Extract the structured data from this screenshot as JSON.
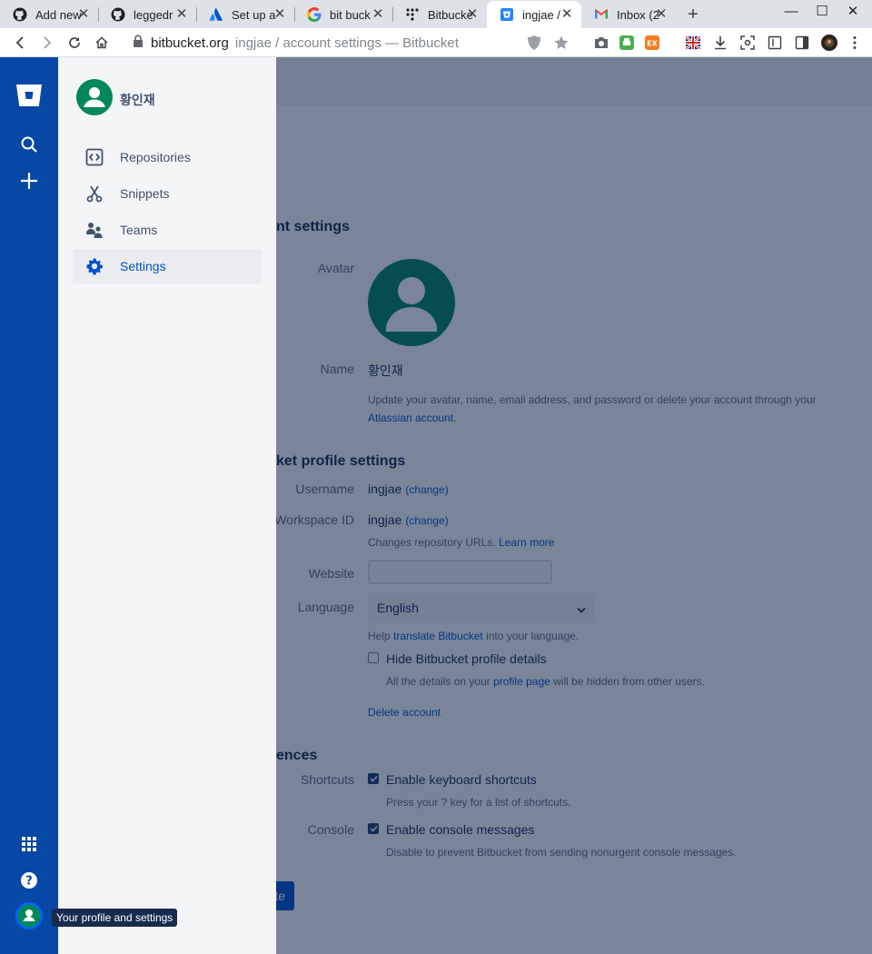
{
  "browser": {
    "tabs": [
      {
        "title": "Add new",
        "icon": "github-icon"
      },
      {
        "title": "leggedr",
        "icon": "github-icon"
      },
      {
        "title": "Set up a",
        "icon": "atlassian-icon"
      },
      {
        "title": "bit buck",
        "icon": "google-icon"
      },
      {
        "title": "Bitbucke",
        "icon": "trello-dots-icon"
      },
      {
        "title": "ingjae /",
        "icon": "bitbucket-icon"
      },
      {
        "title": "Inbox (2",
        "icon": "gmail-icon"
      }
    ],
    "url_host": "bitbucket.org",
    "url_path": "ingjae / account settings — Bitbucket"
  },
  "sidebar": {
    "user_name": "황인재",
    "items": [
      {
        "label": "Repositories",
        "icon": "repository-icon"
      },
      {
        "label": "Snippets",
        "icon": "snippets-icon"
      },
      {
        "label": "Teams",
        "icon": "teams-icon"
      },
      {
        "label": "Settings",
        "icon": "gear-icon"
      }
    ]
  },
  "globalnav": {
    "tooltip": "Your profile and settings"
  },
  "account": {
    "heading": "nt settings",
    "avatar_label": "Avatar",
    "name_label": "Name",
    "name_value": "황인재",
    "help_text": "Update your avatar, name, email address, and password or delete your account through your",
    "help_link": "Atlassian account",
    "help_suffix": "."
  },
  "profile": {
    "heading": "ket profile settings",
    "username_label": "Username",
    "username_value": "ingjae",
    "change_label": "(change)",
    "workspace_label": "Workspace ID",
    "workspace_value": "ingjae",
    "workspace_help": "Changes repository URLs.",
    "learn_more": "Learn more",
    "website_label": "Website",
    "website_value": "",
    "language_label": "Language",
    "language_value": "English",
    "translate_prefix": "Help",
    "translate_link": "translate Bitbucket",
    "translate_suffix": "into your language.",
    "hide_label": "Hide Bitbucket profile details",
    "hide_checked": false,
    "hide_help_prefix": "All the details on your",
    "hide_help_link": "profile page",
    "hide_help_suffix": "will be hidden from other users.",
    "delete_account": "Delete account"
  },
  "preferences": {
    "heading": "ences",
    "shortcuts_label": "Shortcuts",
    "shortcuts_option": "Enable keyboard shortcuts",
    "shortcuts_checked": true,
    "shortcuts_help": "Press your ? key for a list of shortcuts.",
    "console_label": "Console",
    "console_option": "Enable console messages",
    "console_checked": true,
    "console_help": "Disable to prevent Bitbucket from sending nonurgent console messages.",
    "submit_label": "te"
  },
  "colors": {
    "globalnav": "#0747a6",
    "avatar": "#00875a",
    "link": "#0052cc"
  }
}
